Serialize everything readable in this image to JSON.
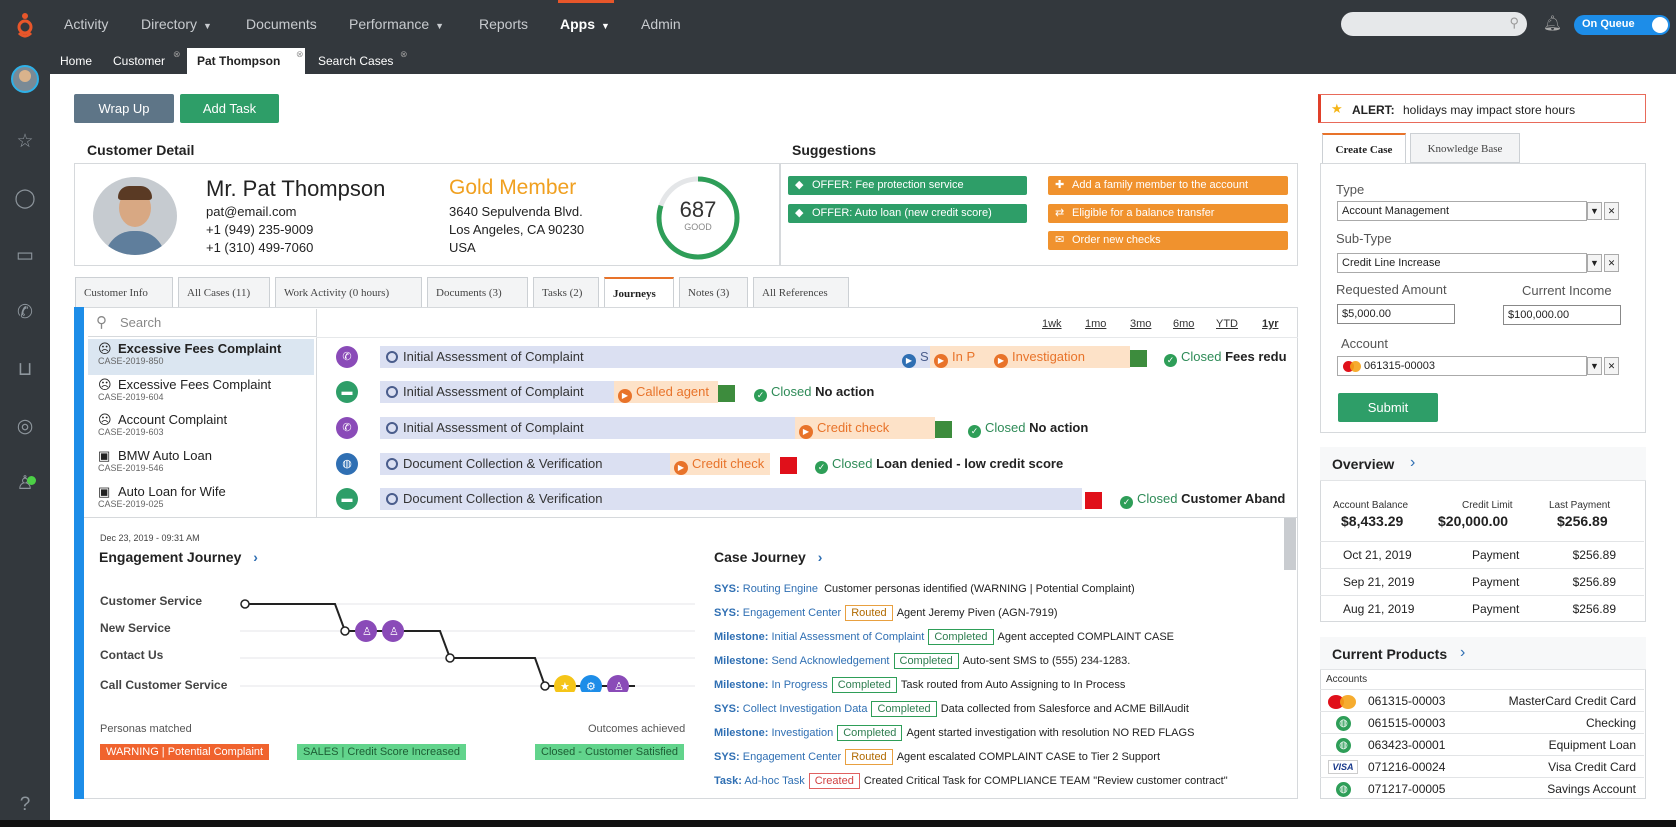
{
  "topnav": {
    "items": [
      "Activity",
      "Directory",
      "Documents",
      "Performance",
      "Reports",
      "Apps",
      "Admin"
    ],
    "queue_label": "On Queue"
  },
  "tabs": [
    {
      "label": "Home"
    },
    {
      "label": "Customer"
    },
    {
      "label": "Pat Thompson"
    },
    {
      "label": "Search Cases"
    }
  ],
  "actions": {
    "wrap_up": "Wrap Up",
    "add_task": "Add Task"
  },
  "customer": {
    "header": "Customer Detail",
    "name": "Mr. Pat Thompson",
    "email": "pat@email.com",
    "phone1": "+1 (949) 235-9009",
    "phone2": "+1 (310) 499-7060",
    "tier": "Gold Member",
    "address1": "3640 Sepulvenda Blvd.",
    "address2": "Los Angeles, CA 90230",
    "country": "USA",
    "score": "687",
    "score_label": "GOOD",
    "score_fraction": 0.8
  },
  "suggestions": {
    "header": "Suggestions",
    "offers": [
      "OFFER: Fee protection service",
      "OFFER: Auto loan (new credit score)"
    ],
    "actions": [
      "Add a family member to the account",
      "Eligible for a balance transfer",
      "Order new checks"
    ]
  },
  "content_tabs": [
    "Customer Info",
    "All Cases (11)",
    "Work Activity (0 hours)",
    "Documents (3)",
    "Tasks (2)",
    "Journeys",
    "Notes (3)",
    "All References"
  ],
  "search_placeholder": "Search",
  "ranges": [
    "1wk",
    "1mo",
    "3mo",
    "6mo",
    "YTD",
    "1yr"
  ],
  "cases": [
    {
      "title": "Excessive Fees Complaint",
      "id": "CASE-2019-850"
    },
    {
      "title": "Excessive Fees Complaint",
      "id": "CASE-2019-604"
    },
    {
      "title": "Account Complaint",
      "id": "CASE-2019-603"
    },
    {
      "title": "BMW Auto Loan",
      "id": "CASE-2019-546"
    },
    {
      "title": "Auto Loan for Wife",
      "id": "CASE-2019-025"
    }
  ],
  "journeys": [
    {
      "start": "Initial Assessment of Complaint",
      "stages": [
        "S",
        "In P",
        "Investigation"
      ],
      "closed": "Closed",
      "result": "Fees redu"
    },
    {
      "start": "Initial Assessment of Complaint",
      "stages": [
        "Called agent"
      ],
      "closed": "Closed",
      "result": "No action"
    },
    {
      "start": "Initial Assessment of Complaint",
      "stages": [
        "Credit check"
      ],
      "closed": "Closed",
      "result": "No action"
    },
    {
      "start": "Document Collection & Verification",
      "stages": [
        "Credit check"
      ],
      "closed": "Closed",
      "result": "Loan denied - low credit score"
    },
    {
      "start": "Document Collection & Verification",
      "stages": [],
      "closed": "Closed",
      "result": "Customer Aband"
    }
  ],
  "engagement": {
    "date": "Dec 23, 2019 - 09:31 AM",
    "title": "Engagement Journey",
    "lanes": [
      "Customer Service",
      "New Service",
      "Contact Us",
      "Call Customer Service"
    ],
    "personas_label": "Personas matched",
    "outcomes_label": "Outcomes achieved",
    "tags": [
      "WARNING | Potential Complaint",
      "SALES | Credit Score Increased",
      "Closed - Customer Satisfied"
    ]
  },
  "case_journey": {
    "title": "Case Journey",
    "entries": [
      {
        "kind": "SYS:",
        "link": "Routing Engine",
        "badge": "",
        "text": "Customer personas identified (WARNING | Potential Complaint)"
      },
      {
        "kind": "SYS:",
        "link": "Engagement Center",
        "badge": "Routed",
        "text": "Agent Jeremy Piven (AGN-7919)"
      },
      {
        "kind": "Milestone:",
        "link": "Initial Assessment of Complaint",
        "badge": "Completed",
        "text": "Agent accepted COMPLAINT CASE"
      },
      {
        "kind": "Milestone:",
        "link": "Send Acknowledgement",
        "badge": "Completed",
        "text": "Auto-sent SMS to (555) 234-1283."
      },
      {
        "kind": "Milestone:",
        "link": "In Progress",
        "badge": "Completed",
        "text": "Task routed from Auto Assigning to In Process"
      },
      {
        "kind": "SYS:",
        "link": "Collect Investigation Data",
        "badge": "Completed",
        "text": "Data collected from Salesforce and ACME BillAudit"
      },
      {
        "kind": "Milestone:",
        "link": "Investigation",
        "badge": "Completed",
        "text": "Agent started investigation with resolution NO RED FLAGS"
      },
      {
        "kind": "SYS:",
        "link": "Engagement Center",
        "badge": "Routed",
        "text": "Agent escalated COMPLAINT CASE to Tier 2 Support"
      },
      {
        "kind": "Task:",
        "link": "Ad-hoc Task",
        "badge": "Created",
        "text": "Created Critical Task for COMPLIANCE TEAM \"Review customer contract\""
      }
    ]
  },
  "alert": {
    "label": "ALERT:",
    "text": "holidays may impact store hours"
  },
  "right_tabs": [
    "Create Case",
    "Knowledge Base"
  ],
  "create_case": {
    "type_label": "Type",
    "type_value": "Account Management",
    "subtype_label": "Sub-Type",
    "subtype_value": "Credit Line Increase",
    "amount_label": "Requested Amount",
    "amount_value": "$5,000.00",
    "income_label": "Current Income",
    "income_value": "$100,000.00",
    "account_label": "Account",
    "account_value": "061315-00003",
    "submit": "Submit"
  },
  "overview": {
    "title": "Overview",
    "stats": [
      {
        "label": "Account Balance",
        "value": "$8,433.29"
      },
      {
        "label": "Credit Limit",
        "value": "$20,000.00"
      },
      {
        "label": "Last Payment",
        "value": "$256.89"
      }
    ],
    "payments": [
      {
        "date": "Oct 21, 2019",
        "type": "Payment",
        "amount": "$256.89"
      },
      {
        "date": "Sep 21, 2019",
        "type": "Payment",
        "amount": "$256.89"
      },
      {
        "date": "Aug 21, 2019",
        "type": "Payment",
        "amount": "$256.89"
      }
    ]
  },
  "products": {
    "title": "Current Products",
    "accounts_label": "Accounts",
    "items": [
      {
        "number": "061315-00003",
        "name": "MasterCard Credit Card",
        "icon": "mastercard-icon"
      },
      {
        "number": "061515-00003",
        "name": "Checking",
        "icon": "globe-icon"
      },
      {
        "number": "063423-00001",
        "name": "Equipment Loan",
        "icon": "globe-icon"
      },
      {
        "number": "071216-00024",
        "name": "Visa Credit Card",
        "icon": "visa-icon"
      },
      {
        "number": "071217-00005",
        "name": "Savings Account",
        "icon": "globe-icon"
      }
    ]
  },
  "colors": {
    "accent": "#e8732a",
    "green": "#2e9e58",
    "blue": "#2f6fb3",
    "nav": "#33383d",
    "purple": "#8a4bb8"
  }
}
